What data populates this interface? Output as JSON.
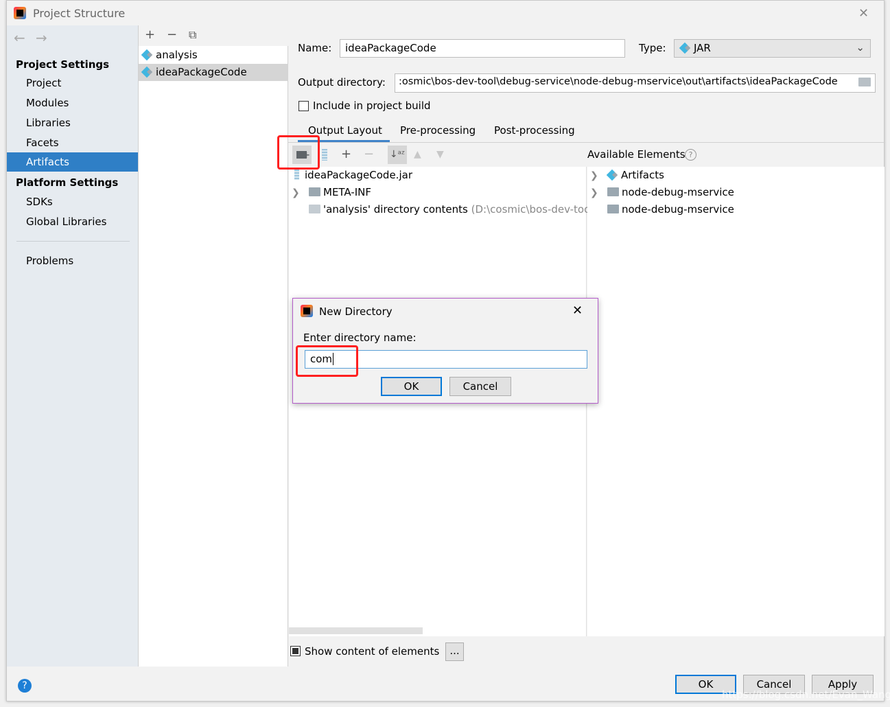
{
  "window": {
    "title": "Project Structure",
    "close": "✕"
  },
  "sidebar": {
    "project_settings": "Project Settings",
    "items": [
      "Project",
      "Modules",
      "Libraries",
      "Facets",
      "Artifacts"
    ],
    "platform_settings": "Platform Settings",
    "platform_items": [
      "SDKs",
      "Global Libraries"
    ],
    "problems": "Problems",
    "selected": "Artifacts"
  },
  "artifact_list": {
    "items": [
      "analysis",
      "ideaPackageCode"
    ],
    "selected": "ideaPackageCode"
  },
  "form": {
    "name_label": "Name:",
    "name_value": "ideaPackageCode",
    "type_label": "Type:",
    "type_value": "JAR",
    "output_label": "Output directory:",
    "output_value": ":osmic\\bos-dev-tool\\debug-service\\node-debug-mservice\\out\\artifacts\\ideaPackageCode",
    "include_build": "Include in project build",
    "include_checked": false
  },
  "tabs": [
    "Output Layout",
    "Pre-processing",
    "Post-processing"
  ],
  "active_tab": "Output Layout",
  "layout_tree": {
    "root": "ideaPackageCode.jar",
    "meta": "META-INF",
    "contents": "'analysis' directory contents",
    "contents_path": "(D:\\cosmic\\bos-dev-tool"
  },
  "available": {
    "title": "Available Elements",
    "items": [
      "Artifacts",
      "node-debug-mservice",
      "node-debug-mservice"
    ]
  },
  "show_content": {
    "label": "Show content of elements",
    "checked": true,
    "more": "..."
  },
  "dialog": {
    "title": "New Directory",
    "prompt": "Enter directory name:",
    "value": "com",
    "ok": "OK",
    "cancel": "Cancel"
  },
  "footer": {
    "ok": "OK",
    "cancel": "Cancel",
    "apply": "Apply",
    "help": "?"
  },
  "watermark": "https://blog.csdn.net/Evan_Wang",
  "colors": {
    "selection": "#2f7fc6",
    "highlight": "#ff2020",
    "sidebar": "#e6ebf0"
  }
}
